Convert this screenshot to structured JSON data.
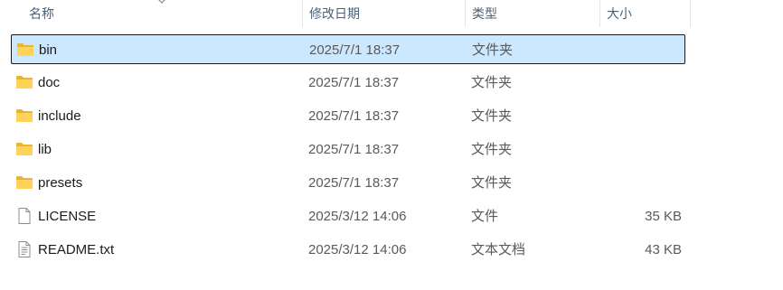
{
  "columns": {
    "name": "名称",
    "modified": "修改日期",
    "type": "类型",
    "size": "大小"
  },
  "rows": [
    {
      "name": "bin",
      "modified": "2025/7/1 18:37",
      "type": "文件夹",
      "size": "",
      "icon": "folder-icon",
      "selected": true
    },
    {
      "name": "doc",
      "modified": "2025/7/1 18:37",
      "type": "文件夹",
      "size": "",
      "icon": "folder-icon",
      "selected": false
    },
    {
      "name": "include",
      "modified": "2025/7/1 18:37",
      "type": "文件夹",
      "size": "",
      "icon": "folder-icon",
      "selected": false
    },
    {
      "name": "lib",
      "modified": "2025/7/1 18:37",
      "type": "文件夹",
      "size": "",
      "icon": "folder-icon",
      "selected": false
    },
    {
      "name": "presets",
      "modified": "2025/7/1 18:37",
      "type": "文件夹",
      "size": "",
      "icon": "folder-icon",
      "selected": false
    },
    {
      "name": "LICENSE",
      "modified": "2025/3/12 14:06",
      "type": "文件",
      "size": "35 KB",
      "icon": "file-icon",
      "selected": false
    },
    {
      "name": "README.txt",
      "modified": "2025/3/12 14:06",
      "type": "文本文档",
      "size": "43 KB",
      "icon": "text-file-icon",
      "selected": false
    }
  ],
  "colors": {
    "selection_bg": "#cce8ff",
    "selection_border": "#1a1a1a",
    "folder_yellow": "#ffd35a",
    "header_text": "#4c607a"
  }
}
